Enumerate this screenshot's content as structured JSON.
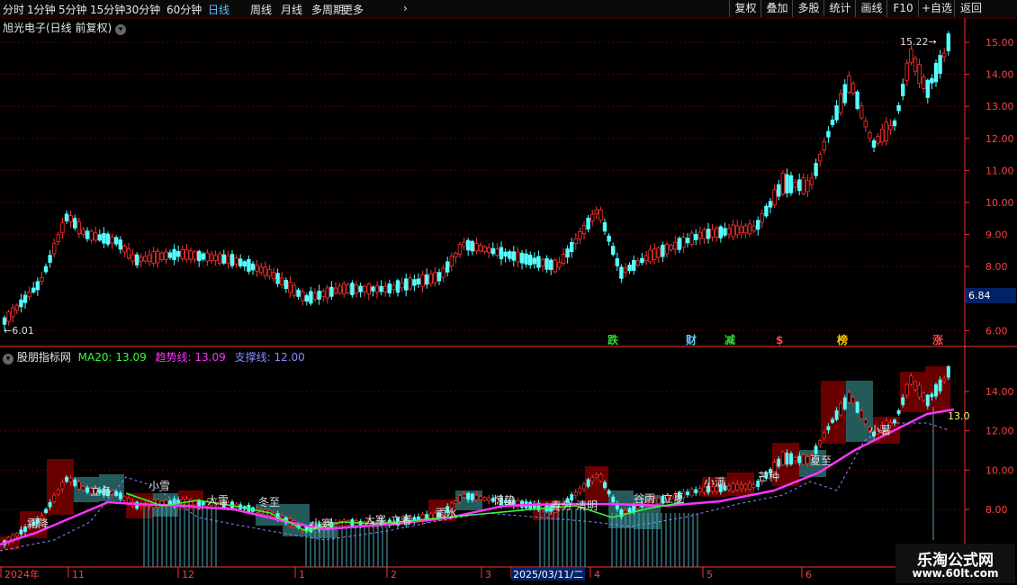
{
  "toolbar": {
    "periods": [
      "分时",
      "1分钟",
      "5分钟",
      "15分钟",
      "30分钟",
      "60分钟",
      "日线",
      "周线",
      "月线",
      "多周期",
      "更多"
    ],
    "active_period": "日线",
    "right_buttons": [
      "复权",
      "叠加",
      "多股",
      "统计",
      "画线",
      "F10",
      "+自选",
      "返回"
    ]
  },
  "upper_panel": {
    "title": "旭光电子(日线 前复权)",
    "price_axis": [
      "15.00",
      "14.00",
      "13.00",
      "12.00",
      "11.00",
      "10.00",
      "9.00",
      "8.00",
      "6.00"
    ],
    "high_label": "15.22",
    "low_label": "6.01",
    "current_price": "6.84",
    "event_markers": [
      {
        "text": "跌",
        "color": "#33dd33"
      },
      {
        "text": "财",
        "color": "#66ccff"
      },
      {
        "text": "减",
        "color": "#33dd33"
      },
      {
        "text": "$",
        "color": "#ff4444"
      },
      {
        "text": "榜",
        "color": "#ffcc00"
      },
      {
        "text": "涨",
        "color": "#ff4444"
      }
    ]
  },
  "lower_panel": {
    "title": "股朋指标网",
    "ma20": "MA20: 13.09",
    "trend": "趋势线: 13.09",
    "support": "支撑线: 12.00",
    "price_axis": [
      "14.00",
      "12.00",
      "10.00",
      "8.00"
    ],
    "last_value": "13.0",
    "solar_terms": [
      "霜降",
      "立冬",
      "小雪",
      "大雪",
      "冬至",
      "小寒",
      "大寒",
      "立春",
      "雨水",
      "惊蛰",
      "春分",
      "清明",
      "谷雨",
      "立夏",
      "小满",
      "芒种",
      "夏至",
      "小暑"
    ]
  },
  "time_axis": [
    "2024年",
    "11",
    "12",
    "1",
    "2",
    "3",
    "2025/03/11/二",
    "4",
    "5",
    "6"
  ],
  "watermark": {
    "line1": "乐淘公式网",
    "line2": "www.60lt.com"
  },
  "colors": {
    "up": "#ff3030",
    "down": "#54ffff",
    "ma20": "#33ff33",
    "trend": "#ff33ff",
    "support": "#8a8aff",
    "grid": "#5a0000",
    "axis": "#ff3030"
  }
}
